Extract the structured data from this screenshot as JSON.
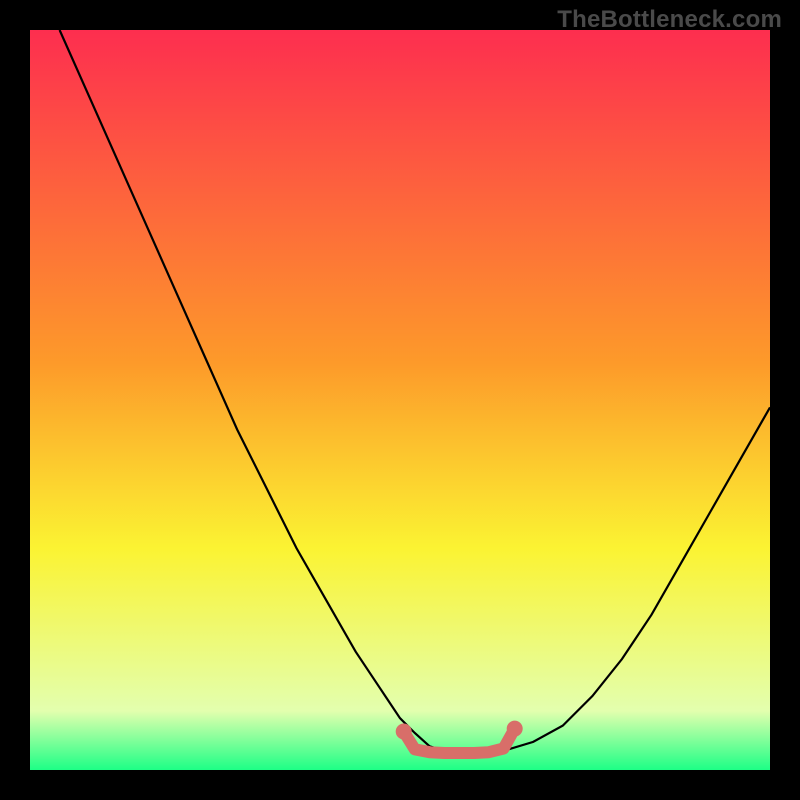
{
  "watermark": "TheBottleneck.com",
  "colors": {
    "background": "#000000",
    "gradient_top": "#fd2e4f",
    "gradient_orange": "#fd9a2a",
    "gradient_yellow": "#fbf332",
    "gradient_pale": "#e3ffae",
    "gradient_bottom": "#1dff86",
    "curve": "#000000",
    "marker": "#d86e69"
  },
  "chart_data": {
    "type": "line",
    "title": "",
    "xlabel": "",
    "ylabel": "",
    "xlim": [
      0,
      100
    ],
    "ylim": [
      0,
      100
    ],
    "series": [
      {
        "name": "curve",
        "x": [
          4,
          8,
          12,
          16,
          20,
          24,
          28,
          32,
          36,
          40,
          44,
          48,
          50,
          52,
          54,
          56,
          58,
          60,
          62,
          64,
          68,
          72,
          76,
          80,
          84,
          88,
          92,
          96,
          100
        ],
        "y": [
          100,
          91,
          82,
          73,
          64,
          55,
          46,
          38,
          30,
          23,
          16,
          10,
          7,
          5,
          3.2,
          2.6,
          2.4,
          2.4,
          2.4,
          2.6,
          3.8,
          6,
          10,
          15,
          21,
          28,
          35,
          42,
          49
        ]
      }
    ],
    "markers": {
      "name": "highlight",
      "x": [
        50.5,
        52,
        54,
        56,
        58,
        60,
        62,
        64,
        65.5
      ],
      "y": [
        5.2,
        2.8,
        2.4,
        2.3,
        2.3,
        2.3,
        2.4,
        2.9,
        5.6
      ]
    }
  }
}
